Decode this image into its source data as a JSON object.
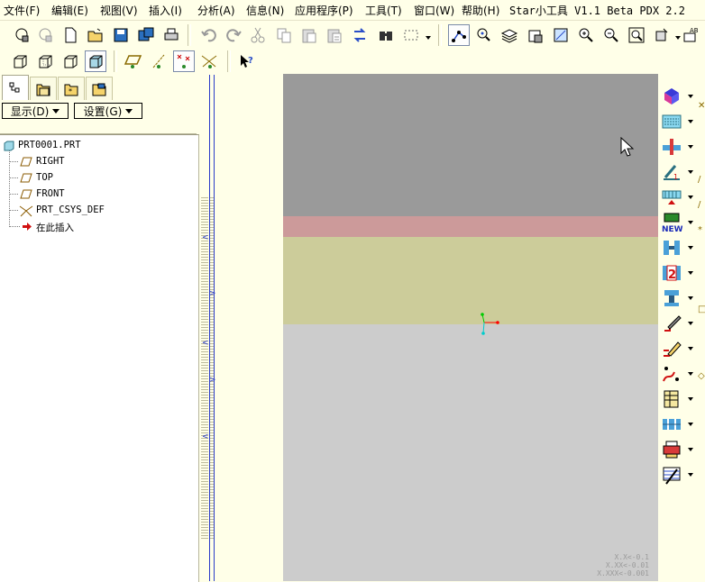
{
  "menu": {
    "items": [
      "文件(F)",
      "编辑(E)",
      "视图(V)",
      "插入(I)",
      "分析(A)",
      "信息(N)",
      "应用程序(P)",
      "工具(T)",
      "窗口(W)",
      "帮助(H)"
    ],
    "plugin_info": "Star小工具 V1.1 Beta  PDX 2.2"
  },
  "toolbar_top": {
    "icons": [
      "open-from-session-icon",
      "erase-not-displayed-icon",
      "new-file-icon",
      "open-file-icon",
      "save-icon",
      "save-copy-icon",
      "print-icon",
      "undo-icon",
      "redo-icon",
      "cut-icon",
      "copy-icon",
      "paste-icon",
      "paste-special-icon",
      "regenerate-icon",
      "find-icon",
      "select-box-icon",
      "datum-display-icon",
      "spin-center-icon",
      "layers-icon",
      "model-tree-icon",
      "saved-views-icon",
      "zoom-in-icon",
      "zoom-out-icon",
      "refit-icon",
      "reorient-icon",
      "annotation-icon"
    ]
  },
  "toolbar_second": {
    "icons": [
      "shading-wireframe-icon",
      "hidden-line-icon",
      "no-hidden-icon",
      "shading-icon",
      "datum-planes-icon",
      "datum-axes-icon",
      "datum-points-icon",
      "coordinate-systems-icon",
      "context-help-icon"
    ]
  },
  "navigator": {
    "tabs": [
      "model-tree-tab",
      "folder-browser-tab",
      "favorites-tab",
      "connections-tab"
    ],
    "show_button": "显示(D)",
    "settings_button": "设置(G)",
    "tree": {
      "root": "PRT0001.PRT",
      "items": [
        {
          "label": "RIGHT",
          "icon": "datum-plane-icon"
        },
        {
          "label": "TOP",
          "icon": "datum-plane-icon"
        },
        {
          "label": "FRONT",
          "icon": "datum-plane-icon"
        },
        {
          "label": "PRT_CSYS_DEF",
          "icon": "coordinate-system-icon"
        },
        {
          "label": "在此插入",
          "icon": "insert-here-arrow-icon"
        }
      ]
    }
  },
  "graphics": {
    "bands": [
      "#9a9a9a",
      "#cc9a9a",
      "#cccc9a",
      "#cccccc"
    ],
    "coord_readout": [
      "X.X<-0.1",
      "X.XX<-0.01",
      "X.XXX<-0.001"
    ]
  },
  "colors": {
    "app_bg": "#ffffe8",
    "axis_x": "#ff0000",
    "axis_y": "#00cc00",
    "axis_z": "#00cccc"
  },
  "right_toolbar": {
    "icons": [
      "protrusion-icon",
      "hatch-icon",
      "hole-icon",
      "draft-icon",
      "rib-icon",
      "new-feature-icon",
      "shell-icon",
      "pattern-icon",
      "insert-icon",
      "sketch-edit-icon",
      "sketch-pen-icon",
      "datum-curve-icon",
      "table-icon",
      "cross-section-icon",
      "printer-icon",
      "texture-icon"
    ]
  }
}
